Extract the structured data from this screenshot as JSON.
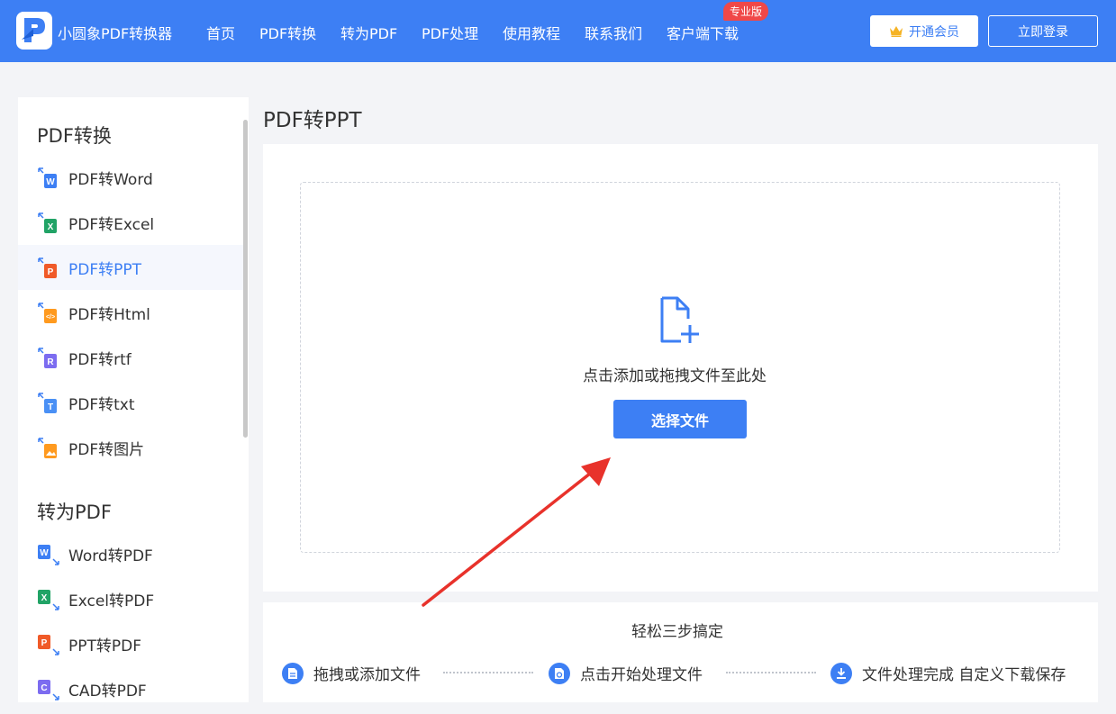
{
  "header": {
    "brand": "小圆象PDF转换器",
    "nav": [
      "首页",
      "PDF转换",
      "转为PDF",
      "PDF处理",
      "使用教程",
      "联系我们",
      "客户端下载"
    ],
    "badge": "专业版",
    "vip_label": "开通会员",
    "login_label": "立即登录",
    "accent": "#3d7ff4"
  },
  "sidebar": {
    "section1_title": "PDF转换",
    "section1_items": [
      {
        "label": "PDF转Word",
        "icon": "word-icon",
        "color": "#3d7ff4"
      },
      {
        "label": "PDF转Excel",
        "icon": "excel-icon",
        "color": "#21a366"
      },
      {
        "label": "PDF转PPT",
        "icon": "ppt-icon",
        "color": "#f05a28"
      },
      {
        "label": "PDF转Html",
        "icon": "html-icon",
        "color": "#ff9a1f"
      },
      {
        "label": "PDF转rtf",
        "icon": "rtf-icon",
        "color": "#7c6cf0"
      },
      {
        "label": "PDF转txt",
        "icon": "txt-icon",
        "color": "#4a90f5"
      },
      {
        "label": "PDF转图片",
        "icon": "image-icon",
        "color": "#ff9a1f"
      }
    ],
    "section2_title": "转为PDF",
    "section2_items": [
      {
        "label": "Word转PDF",
        "icon": "word-icon",
        "color": "#3d7ff4"
      },
      {
        "label": "Excel转PDF",
        "icon": "excel-icon",
        "color": "#21a366"
      },
      {
        "label": "PPT转PDF",
        "icon": "ppt-icon",
        "color": "#f05a28"
      },
      {
        "label": "CAD转PDF",
        "icon": "cad-icon",
        "color": "#7c6cf0"
      }
    ],
    "active": "PDF转PPT"
  },
  "main": {
    "title": "PDF转PPT",
    "drop_hint": "点击添加或拖拽文件至此处",
    "select_label": "选择文件",
    "steps_title": "轻松三步搞定",
    "steps": [
      "拖拽或添加文件",
      "点击开始处理文件",
      "文件处理完成 自定义下载保存"
    ]
  }
}
